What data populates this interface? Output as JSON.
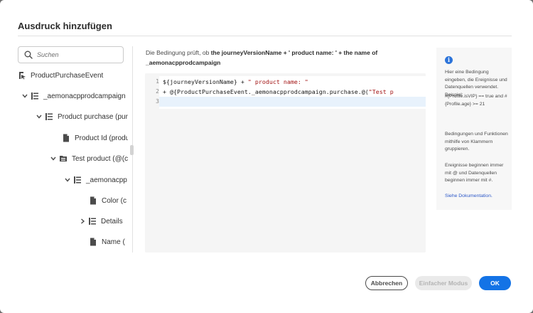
{
  "dialog": {
    "title": "Ausdruck hinzufügen"
  },
  "search": {
    "placeholder": "Suchen"
  },
  "tree": {
    "items": [
      {
        "label": "ProductPurchaseEvent",
        "icon": "event-icon",
        "chevron": "none"
      },
      {
        "label": "_aemonacpprodcampaign",
        "icon": "list-icon",
        "chevron": "down"
      },
      {
        "label": "Product purchase (pur",
        "icon": "list-icon",
        "chevron": "down"
      },
      {
        "label": "Product Id (produ",
        "icon": "file-icon",
        "chevron": "none"
      },
      {
        "label": "Test product (@(c",
        "icon": "collection-icon",
        "chevron": "down"
      },
      {
        "label": "_aemonacpp",
        "icon": "list-icon",
        "chevron": "down"
      },
      {
        "label": "Color (c",
        "icon": "file-icon",
        "chevron": "none"
      },
      {
        "label": "Details",
        "icon": "list-icon",
        "chevron": "right"
      },
      {
        "label": "Name (",
        "icon": "file-icon",
        "chevron": "none"
      }
    ]
  },
  "condition": {
    "prefix": "Die Bedingung prüft, ob",
    "bold_part": "the journeyVersionName + ' product name: ' + the name of _aemonacpprodcampaign"
  },
  "editor": {
    "lines": [
      {
        "num": "1",
        "code_a": "${journeyVersionName} + ",
        "code_str": "\" product name: \"",
        "code_b": ""
      },
      {
        "num": "2",
        "code_a": "+ @{ProductPurchaseEvent._aemonacpprodcampaign.purchase.@(",
        "code_str": "\"Test p",
        "code_b": ""
      },
      {
        "num": "3",
        "code_a": "",
        "code_str": "",
        "code_b": ""
      }
    ]
  },
  "help": {
    "p1": "Hier eine Bedingung eingeben, die Ereignisse und Datenquellen verwendet. Beispiel:",
    "p2": "#{Profile.isVIP} == true and #{Profile.age} >= 21",
    "p3": "Bedingungen und Funktionen mithilfe von Klammern gruppieren.",
    "p4": "Ereignisse beginnen immer mit @ und Datenquellen beginnen immer mit #.",
    "link": "Siehe Dokumentation."
  },
  "footer": {
    "cancel_label": "Abbrechen",
    "simple_label": "Einfacher Modus",
    "ok_label": "OK"
  },
  "colors": {
    "primary": "#1473e6",
    "string": "#a31515",
    "info": "#2d74da",
    "link": "#2d59c8"
  }
}
